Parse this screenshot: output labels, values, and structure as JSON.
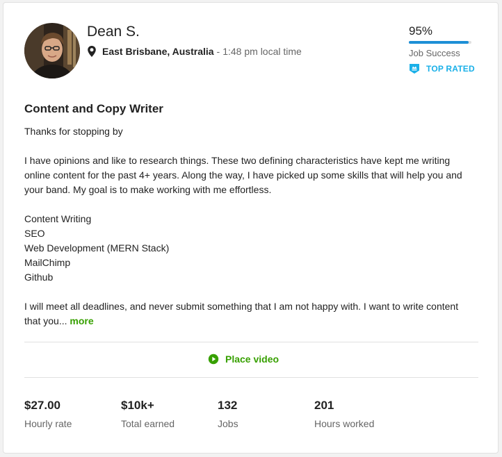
{
  "profile": {
    "name": "Dean S.",
    "location": "East Brisbane, Australia",
    "separator": "-",
    "local_time": "1:48 pm local time",
    "avatar_icon": "avatar-photo"
  },
  "job_success": {
    "percent_label": "95%",
    "percent_value": 95,
    "label": "Job Success",
    "badge": "TOP RATED",
    "bar_color": "#1d8fd6",
    "badge_color": "#1ab0e8"
  },
  "overview": {
    "title": "Content and Copy Writer",
    "intro": "Thanks for stopping by",
    "paragraph": "I have opinions and like to research things. These two defining characteristics have kept me writing online content for the past 4+ years. Along the way, I have picked up some skills that will help you and your band. My goal is to make working with me effortless.",
    "skills": [
      "Content Writing",
      "SEO",
      "Web Development (MERN Stack)",
      "MailChimp",
      "Github"
    ],
    "closing": "I will meet all deadlines, and never submit something that I am not happy with. I want to write content that you...",
    "more_label": "more"
  },
  "video": {
    "label": "Place video",
    "icon": "play-icon",
    "color": "#37a000"
  },
  "stats": [
    {
      "value": "$27.00",
      "label": "Hourly rate"
    },
    {
      "value": "$10k+",
      "label": "Total earned"
    },
    {
      "value": "132",
      "label": "Jobs"
    },
    {
      "value": "201",
      "label": "Hours worked"
    }
  ]
}
